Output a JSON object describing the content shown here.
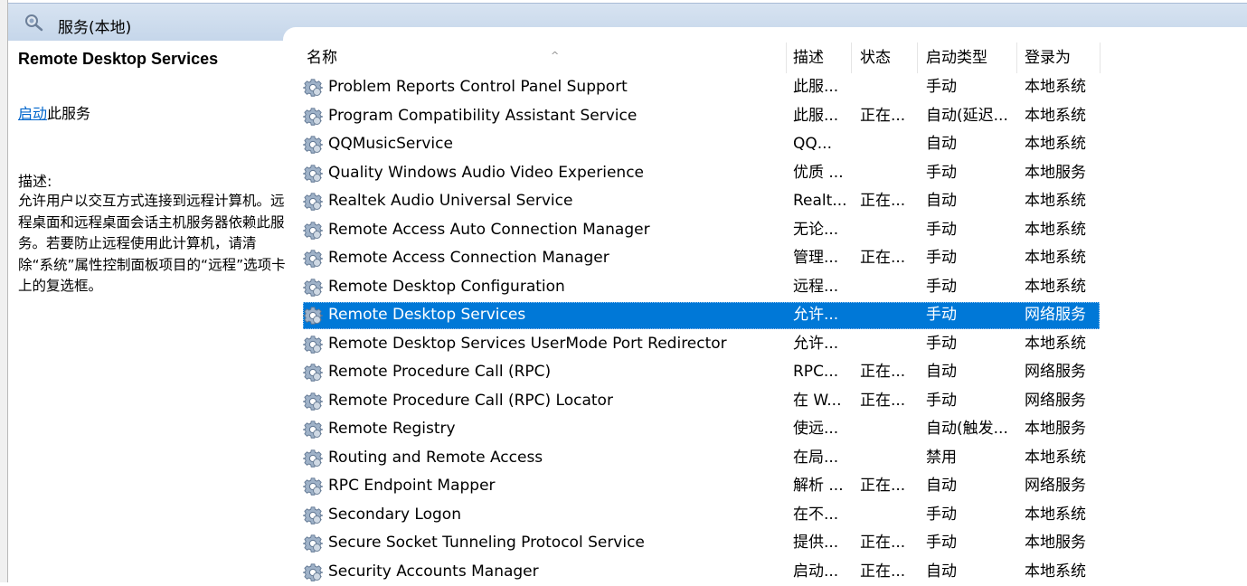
{
  "header": {
    "title": "服务(本地)"
  },
  "left": {
    "service_name": "Remote Desktop Services",
    "start_link": "启动",
    "start_suffix": "此服务",
    "desc_label": "描述:",
    "description": "允许用户以交互方式连接到远程计算机。远程桌面和远程桌面会话主机服务器依赖此服务。若要防止远程使用此计算机，请清除“系统”属性控制面板项目的“远程”选项卡上的复选框。"
  },
  "columns": {
    "name": "名称",
    "description": "描述",
    "status": "状态",
    "startup": "启动类型",
    "logon": "登录为"
  },
  "rows": [
    {
      "name": "Problem Reports Control Panel Support",
      "desc": "此服...",
      "status": "",
      "startup": "手动",
      "logon": "本地系统",
      "selected": false
    },
    {
      "name": "Program Compatibility Assistant Service",
      "desc": "此服...",
      "status": "正在...",
      "startup": "自动(延迟...",
      "logon": "本地系统",
      "selected": false
    },
    {
      "name": "QQMusicService",
      "desc": "QQ...",
      "status": "",
      "startup": "自动",
      "logon": "本地系统",
      "selected": false
    },
    {
      "name": "Quality Windows Audio Video Experience",
      "desc": "优质 ...",
      "status": "",
      "startup": "手动",
      "logon": "本地服务",
      "selected": false
    },
    {
      "name": "Realtek Audio Universal Service",
      "desc": "Realt...",
      "status": "正在...",
      "startup": "自动",
      "logon": "本地系统",
      "selected": false
    },
    {
      "name": "Remote Access Auto Connection Manager",
      "desc": "无论...",
      "status": "",
      "startup": "手动",
      "logon": "本地系统",
      "selected": false
    },
    {
      "name": "Remote Access Connection Manager",
      "desc": "管理...",
      "status": "正在...",
      "startup": "手动",
      "logon": "本地系统",
      "selected": false
    },
    {
      "name": "Remote Desktop Configuration",
      "desc": "远程...",
      "status": "",
      "startup": "手动",
      "logon": "本地系统",
      "selected": false
    },
    {
      "name": "Remote Desktop Services",
      "desc": "允许...",
      "status": "",
      "startup": "手动",
      "logon": "网络服务",
      "selected": true
    },
    {
      "name": "Remote Desktop Services UserMode Port Redirector",
      "desc": "允许...",
      "status": "",
      "startup": "手动",
      "logon": "本地系统",
      "selected": false
    },
    {
      "name": "Remote Procedure Call (RPC)",
      "desc": "RPC...",
      "status": "正在...",
      "startup": "自动",
      "logon": "网络服务",
      "selected": false
    },
    {
      "name": "Remote Procedure Call (RPC) Locator",
      "desc": "在 W...",
      "status": "正在...",
      "startup": "手动",
      "logon": "网络服务",
      "selected": false
    },
    {
      "name": "Remote Registry",
      "desc": "使远...",
      "status": "",
      "startup": "自动(触发...",
      "logon": "本地服务",
      "selected": false
    },
    {
      "name": "Routing and Remote Access",
      "desc": "在局...",
      "status": "",
      "startup": "禁用",
      "logon": "本地系统",
      "selected": false
    },
    {
      "name": "RPC Endpoint Mapper",
      "desc": "解析 ...",
      "status": "正在...",
      "startup": "自动",
      "logon": "网络服务",
      "selected": false
    },
    {
      "name": "Secondary Logon",
      "desc": "在不...",
      "status": "",
      "startup": "手动",
      "logon": "本地系统",
      "selected": false
    },
    {
      "name": "Secure Socket Tunneling Protocol Service",
      "desc": "提供...",
      "status": "正在...",
      "startup": "手动",
      "logon": "本地服务",
      "selected": false
    },
    {
      "name": "Security Accounts Manager",
      "desc": "启动...",
      "status": "正在...",
      "startup": "自动",
      "logon": "本地系统",
      "selected": false
    }
  ],
  "icons": {
    "header": "services-search-icon",
    "row": "gear-icon"
  },
  "colors": {
    "selection": "#0078d7",
    "header_bg": "#c9d9ec",
    "link": "#0066cc"
  }
}
